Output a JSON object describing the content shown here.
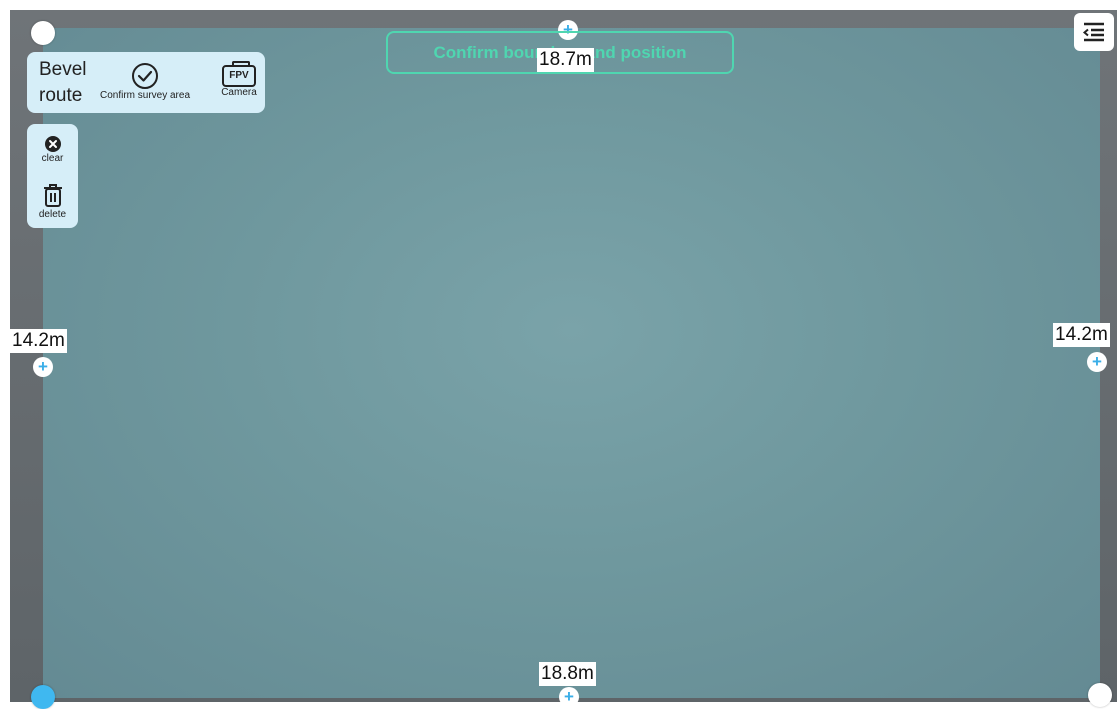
{
  "banner": {
    "text": "Confirm boundary and position"
  },
  "toolbar": {
    "route_label_line1": "Bevel",
    "route_label_line2": "route",
    "confirm_label": "Confirm survey area",
    "camera_label": "Camera",
    "camera_icon_text": "FPV"
  },
  "side_tools": {
    "clear_label": "clear",
    "delete_label": "delete"
  },
  "dimensions": {
    "top": "18.7m",
    "bottom": "18.8m",
    "left": "14.2m",
    "right": "14.2m"
  },
  "colors": {
    "survey_area": "#7aa3a9",
    "accent": "#4fd6b0",
    "active_vertex": "#3fb8f0",
    "panel": "#d6eef8"
  }
}
